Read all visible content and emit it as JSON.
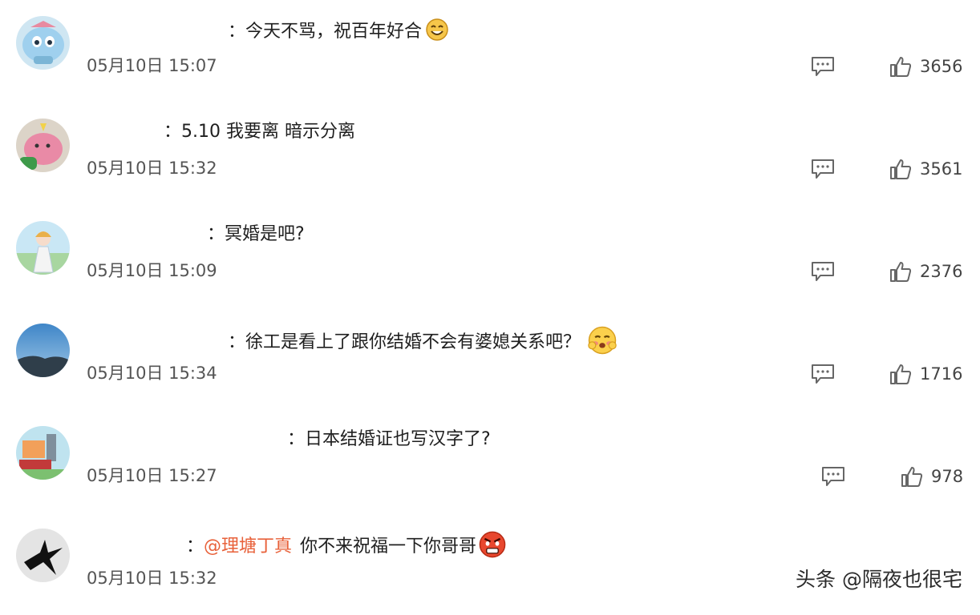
{
  "comments": [
    {
      "text": "：今天不骂，祝百年好合",
      "mention": "",
      "emoji": "smile-face",
      "time": "05月10日 15:07",
      "likes": "3656"
    },
    {
      "text": "：5.10 我要离 暗示分离",
      "mention": "",
      "emoji": "",
      "time": "05月10日 15:32",
      "likes": "3561"
    },
    {
      "text": "：冥婚是吧?",
      "mention": "",
      "emoji": "",
      "time": "05月10日 15:09",
      "likes": "2376"
    },
    {
      "text": "：徐工是看上了跟你结婚不会有婆媳关系吧？",
      "mention": "",
      "emoji": "blush-face",
      "time": "05月10日 15:34",
      "likes": "1716"
    },
    {
      "text": "：日本结婚证也写汉字了?",
      "mention": "",
      "emoji": "",
      "time": "05月10日 15:27",
      "likes": "978"
    },
    {
      "text": "你不来祝福一下你哥哥",
      "mention": "@理塘丁真",
      "prefix": "：",
      "emoji": "angry-face",
      "time": "05月10日 15:32",
      "likes": ""
    }
  ],
  "watermark": "头条 @隔夜也很宅",
  "icons": {
    "reply": "comment-icon",
    "like": "thumbs-up-icon"
  },
  "colors": {
    "mention": "#e8613a",
    "icon": "#666666"
  }
}
